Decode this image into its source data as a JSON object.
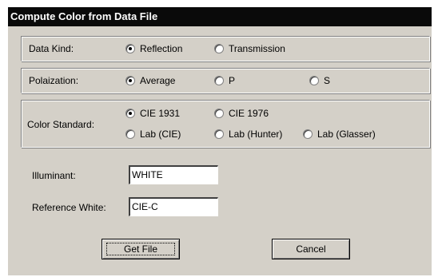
{
  "dialog": {
    "title": "Compute Color from Data File"
  },
  "data_kind": {
    "label": "Data Kind:",
    "options": [
      "Reflection",
      "Transmission"
    ],
    "selected": "Reflection"
  },
  "polarization": {
    "label": "Polaization:",
    "options": [
      "Average",
      "P",
      "S"
    ],
    "selected": "Average"
  },
  "color_standard": {
    "label": "Color Standard:",
    "options": [
      "CIE 1931",
      "CIE 1976",
      "Lab (CIE)",
      "Lab (Hunter)",
      "Lab (Glasser)"
    ],
    "selected": "CIE 1931"
  },
  "illuminant": {
    "label": "Illuminant:",
    "value": "WHITE"
  },
  "reference_white": {
    "label": "Reference White:",
    "value": "CIE-C"
  },
  "buttons": {
    "get_file": "Get File",
    "cancel": "Cancel"
  }
}
